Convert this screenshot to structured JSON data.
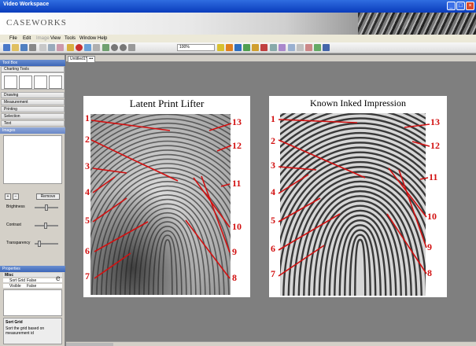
{
  "window": {
    "title": "Video Workspace"
  },
  "brand": {
    "name": "CASEWORKS"
  },
  "menu": [
    "File",
    "Edit",
    "Image",
    "View",
    "Tools",
    "Window",
    "Help"
  ],
  "toolbar": {
    "zoom": "100%"
  },
  "left_panel": {
    "header": "Tool Box",
    "section_charting": "Charting Tools",
    "items": [
      "Drawing",
      "Measurement",
      "Printing",
      "Selection",
      "Text",
      "Images"
    ],
    "remove_button": "Remove",
    "sliders": [
      {
        "label": "Brightness",
        "value": 0.5
      },
      {
        "label": "Contrast",
        "value": 0.45
      },
      {
        "label": "Transparency",
        "value": 0.15
      }
    ],
    "properties": {
      "header": "Properties",
      "group": "Misc",
      "rows": [
        {
          "key": "Sort Grid",
          "value": "False"
        },
        {
          "key": "Visible",
          "value": "False"
        }
      ],
      "help_title": "Sort Grid",
      "help_text": "Sort the grid based on measurement id"
    }
  },
  "tabs": [
    "Untitled1*",
    "•••"
  ],
  "panels": [
    {
      "title": "Latent Print Lifter",
      "left_numbers": [
        "1",
        "2",
        "3",
        "4",
        "5",
        "6",
        "7"
      ],
      "right_numbers": [
        "13",
        "12",
        "11",
        "10",
        "9",
        "8"
      ]
    },
    {
      "title": "Known Inked Impression",
      "left_numbers": [
        "1",
        "2",
        "3",
        "4",
        "5",
        "6",
        "7"
      ],
      "right_numbers": [
        "13",
        "12",
        "11",
        "10",
        "9",
        "8"
      ]
    }
  ],
  "stray_text": "e",
  "colors": {
    "annotation": "#d21010",
    "title_bar": "#0a3cbc",
    "workspace": "#7f7f7f"
  }
}
